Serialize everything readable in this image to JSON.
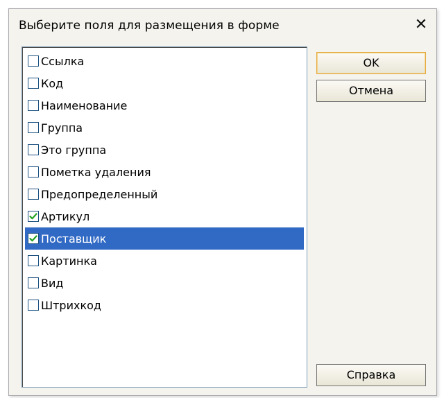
{
  "dialog": {
    "title": "Выберите поля для размещения в форме",
    "close_glyph": "✕"
  },
  "fields": [
    {
      "label": "Ссылка",
      "checked": false
    },
    {
      "label": "Код",
      "checked": false
    },
    {
      "label": "Наименование",
      "checked": false
    },
    {
      "label": "Группа",
      "checked": false
    },
    {
      "label": "Это группа",
      "checked": false
    },
    {
      "label": "Пометка удаления",
      "checked": false
    },
    {
      "label": "Предопределенный",
      "checked": false
    },
    {
      "label": "Артикул",
      "checked": true
    },
    {
      "label": "Поставщик",
      "checked": true,
      "selected": true
    },
    {
      "label": "Картинка",
      "checked": false
    },
    {
      "label": "Вид",
      "checked": false
    },
    {
      "label": "Штрихкод",
      "checked": false
    }
  ],
  "buttons": {
    "ok_label": "OK",
    "cancel_label": "Отмена",
    "help_label": "Справка"
  },
  "colors": {
    "selection": "#316ac5",
    "default_button_border": "#e2a93a"
  },
  "icons": {
    "close": "close-icon",
    "check": "checkmark-icon"
  }
}
